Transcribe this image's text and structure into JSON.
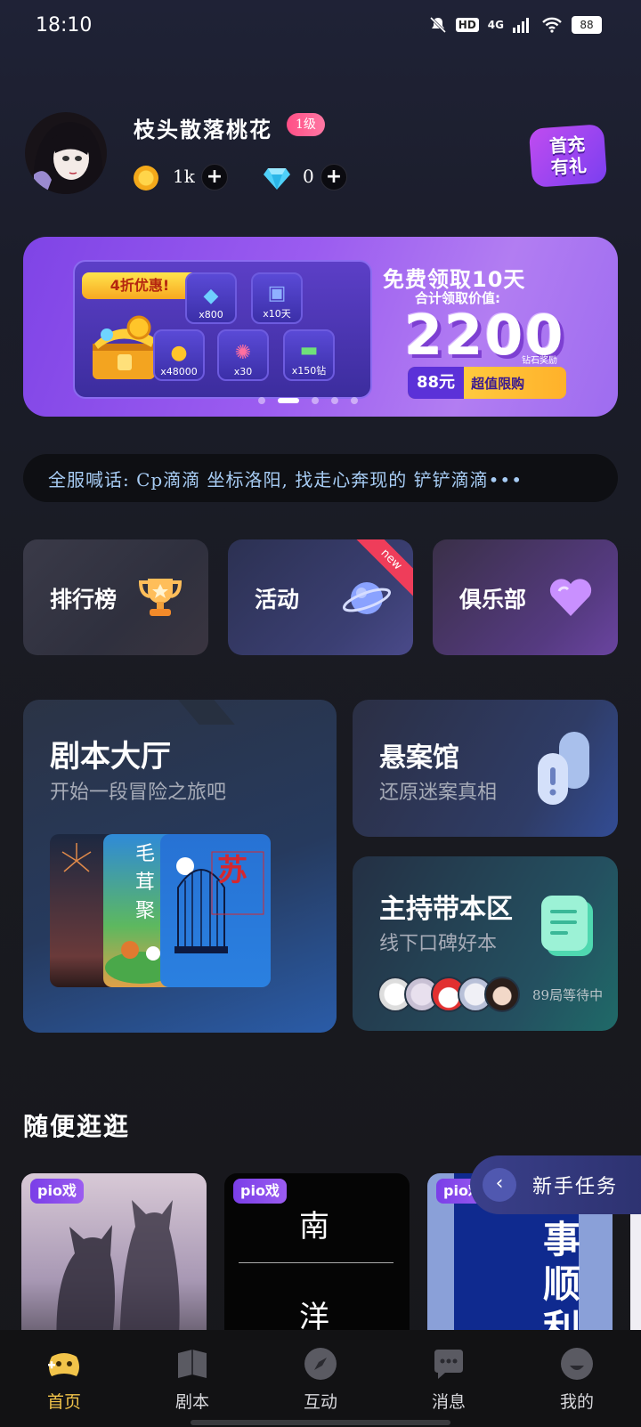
{
  "status_bar": {
    "time": "18:10",
    "network": "4G",
    "hd": "HD",
    "battery": "88"
  },
  "profile": {
    "username": "枝头散落桃花",
    "level": "1级",
    "coins": "1k",
    "diamonds": "0",
    "first_charge": "首充有礼"
  },
  "banner": {
    "discount_tag": "4折优惠!",
    "rewards": [
      "x800",
      "x10天",
      "x48000",
      "x30",
      "x150钻"
    ],
    "title": "免费领取10天",
    "subtitle": "合计领取价值:",
    "value": "2200",
    "value_note": "钻石奖励",
    "price": "88元",
    "price_note": "超值限购",
    "active_slide": 1
  },
  "broadcast": {
    "text": "全服喊话: Cp滴滴 坐标洛阳, 找走心奔现的 铲铲滴滴•••"
  },
  "quick_entries": [
    {
      "label": "排行榜",
      "icon": "trophy-icon"
    },
    {
      "label": "活动",
      "icon": "planet-icon",
      "badge": "new"
    },
    {
      "label": "俱乐部",
      "icon": "heart-icon"
    }
  ],
  "script_hall": {
    "title": "剧本大厅",
    "subtitle": "开始一段冒险之旅吧",
    "book2_text": "毛茸聚",
    "book3_title": "苏"
  },
  "mystery": {
    "title": "悬案馆",
    "subtitle": "还原迷案真相"
  },
  "host": {
    "title": "主持带本区",
    "subtitle": "线下口碑好本",
    "waiting": "89局等待中"
  },
  "section": {
    "title": "随便逛逛"
  },
  "room_cards": [
    {
      "tag": "pio戏"
    },
    {
      "tag": "pio戏",
      "chars": [
        "南",
        "洋"
      ]
    },
    {
      "tag": "pio戏",
      "text": "事顺利"
    }
  ],
  "newbie_task": {
    "label": "新手任务"
  },
  "bottom_nav": [
    {
      "label": "首页",
      "icon": "game-controller-icon",
      "active": true
    },
    {
      "label": "剧本",
      "icon": "book-icon",
      "active": false
    },
    {
      "label": "互动",
      "icon": "compass-icon",
      "active": false
    },
    {
      "label": "消息",
      "icon": "chat-bubble-icon",
      "active": false
    },
    {
      "label": "我的",
      "icon": "profile-icon",
      "active": false
    }
  ],
  "colors": {
    "accent": "#f2c44a",
    "level_badge": "#ff4f86",
    "banner": "#9b5cf0",
    "broadcast_text": "#a7ccf4"
  }
}
